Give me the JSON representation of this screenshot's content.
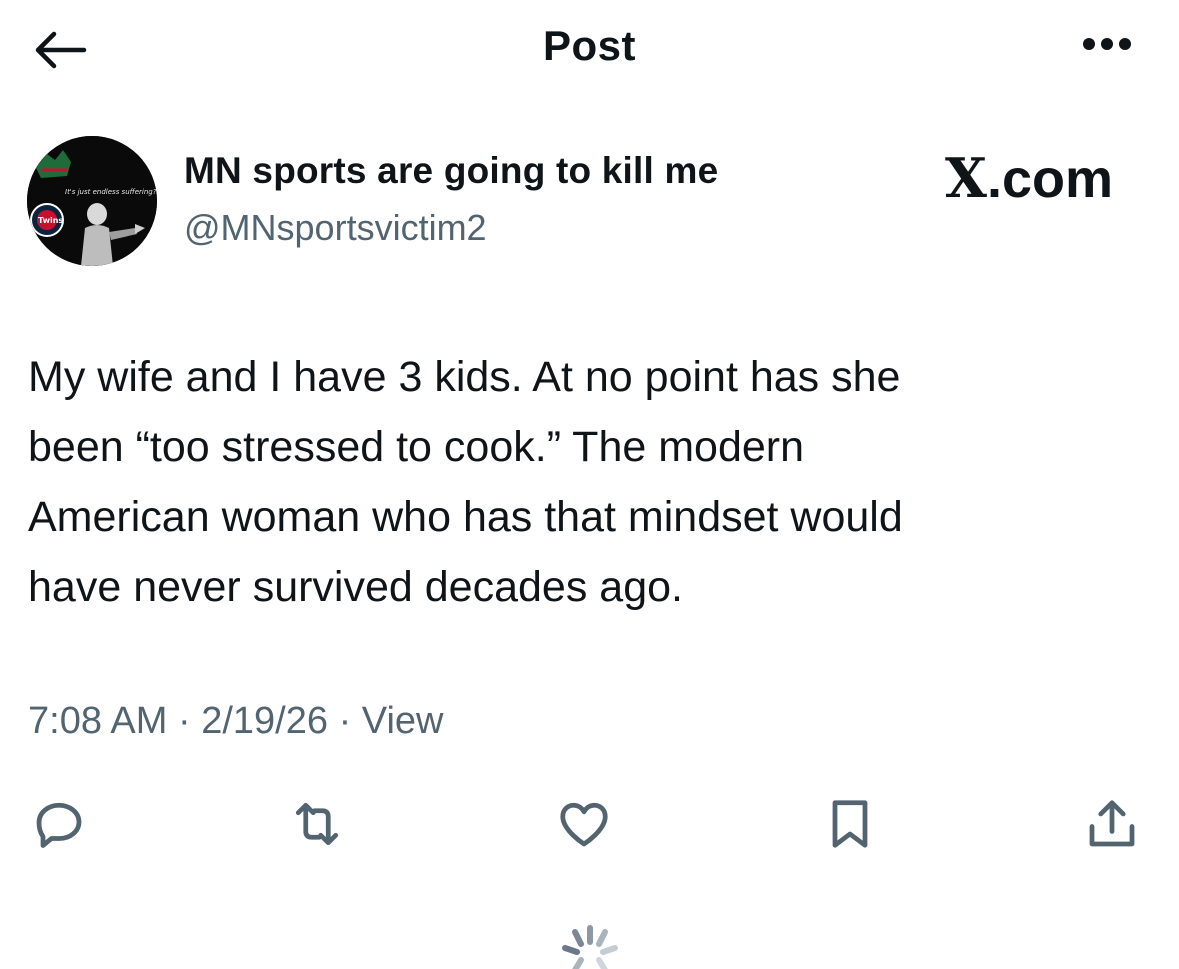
{
  "header": {
    "title": "Post",
    "back_icon": "arrow-left-icon",
    "more_icon": "more-horizontal-icon"
  },
  "author": {
    "display_name": "MN sports are going to kill me",
    "handle": "@MNsportsvictim2",
    "avatar_caption": "It's just endless suffering?"
  },
  "brand": {
    "x": "X",
    "suffix": ".com"
  },
  "tweet": {
    "text": "My wife and I have 3 kids. At no point has she\nbeen “too stressed to cook.” The modern\nAmerican woman who has that mindset would\nhave never survived decades ago."
  },
  "meta": {
    "time": "7:08 AM",
    "separator": "·",
    "date": "2/19/26",
    "view_label": "View"
  },
  "actions": [
    {
      "icon": "reply-icon"
    },
    {
      "icon": "repost-icon"
    },
    {
      "icon": "like-icon"
    },
    {
      "icon": "bookmark-icon"
    },
    {
      "icon": "share-icon"
    }
  ],
  "colors": {
    "text": "#0f1419",
    "secondary": "#536471",
    "icon": "#536471"
  }
}
